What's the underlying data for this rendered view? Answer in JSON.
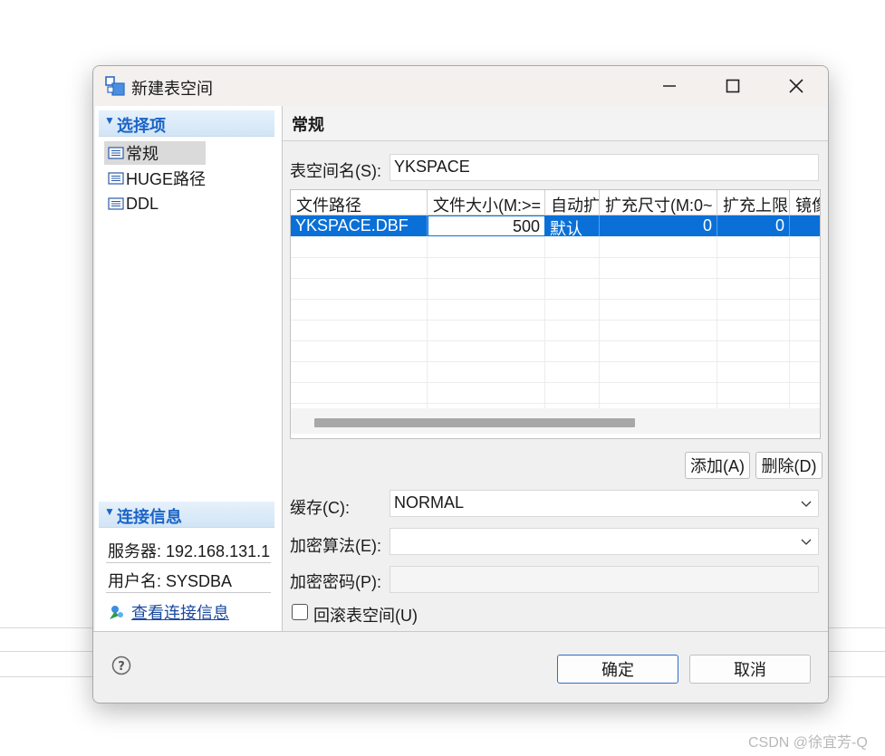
{
  "window": {
    "title": "新建表空间",
    "controls": {
      "minimize": "minimize-icon",
      "maximize": "maximize-icon",
      "close": "close-icon"
    }
  },
  "sidebar": {
    "section_options": "选择项",
    "items": [
      {
        "label": "常规",
        "icon": "page-icon",
        "selected": true
      },
      {
        "label": "HUGE路径",
        "icon": "page-icon",
        "selected": false
      },
      {
        "label": "DDL",
        "icon": "page-icon",
        "selected": false
      }
    ],
    "section_connection": "连接信息",
    "server": "服务器: 192.168.131.1",
    "user": "用户名: SYSDBA",
    "view_conn_link": "查看连接信息"
  },
  "main": {
    "header": "常规",
    "tablespace_label": "表空间名(S):",
    "tablespace_value": "YKSPACE",
    "table": {
      "columns": [
        "文件路径",
        "文件大小(M:>=",
        "自动扩",
        "扩充尺寸(M:0~",
        "扩充上限",
        "镜像"
      ],
      "rows": [
        {
          "path": "YKSPACE.DBF",
          "size": "500",
          "auto": "默认",
          "ext_size": "0",
          "ext_limit": "0"
        }
      ]
    },
    "add_button": "添加(A)",
    "delete_button": "删除(D)",
    "cache_label": "缓存(C):",
    "cache_value": "NORMAL",
    "encrypt_alg_label": "加密算法(E):",
    "encrypt_alg_value": "",
    "encrypt_pwd_label": "加密密码(P):",
    "rollback_label": "回滚表空间(U)",
    "rollback_checked": false
  },
  "footer": {
    "ok": "确定",
    "cancel": "取消"
  },
  "watermark": "CSDN @徐宜芳-Q",
  "colors": {
    "selection": "#0a70d8",
    "section_header": "#1b64c6",
    "link": "#1a4aa0"
  }
}
